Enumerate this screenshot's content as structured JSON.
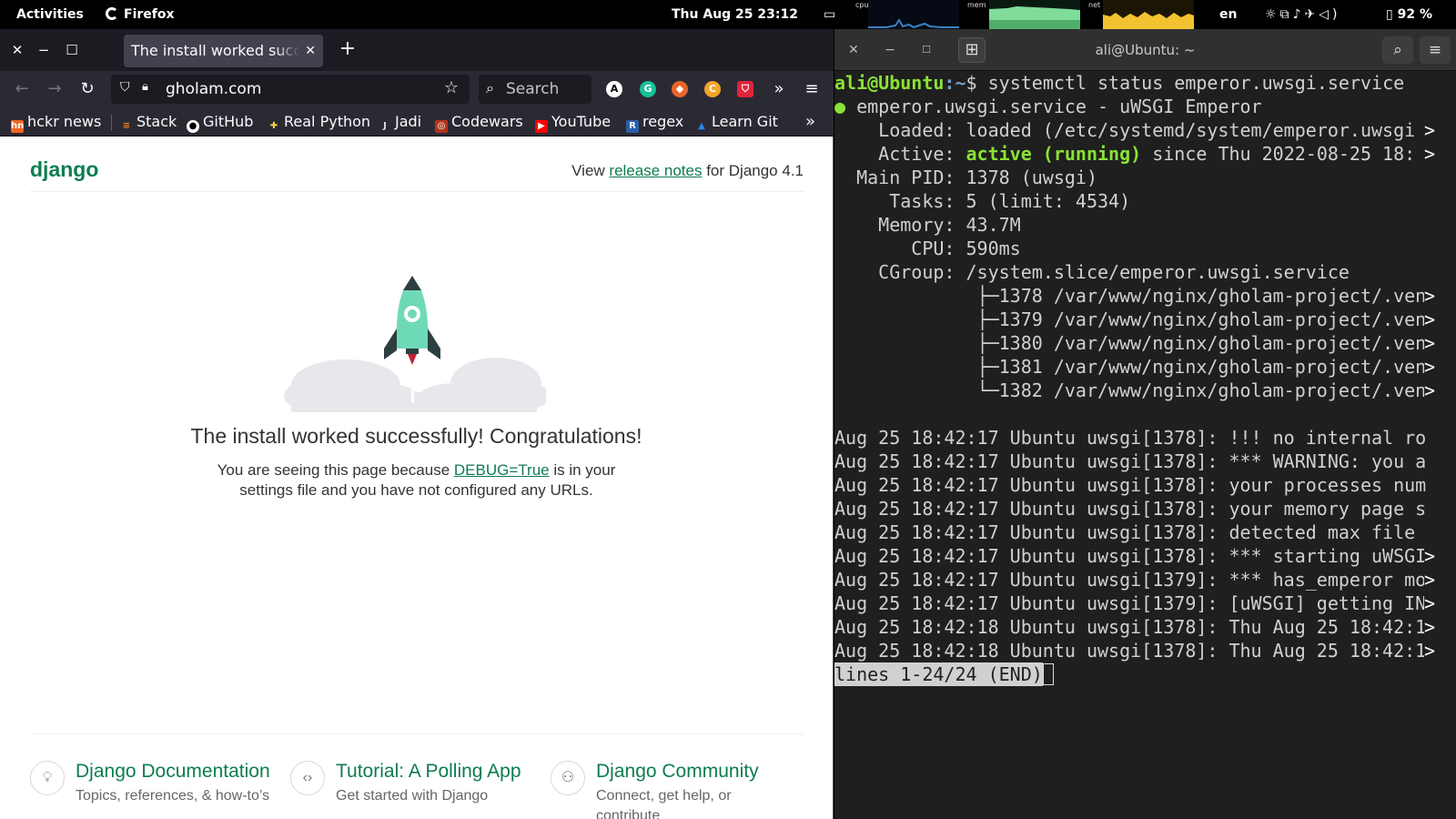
{
  "topbar": {
    "activities": "Activities",
    "app": "Firefox",
    "clock": "Thu Aug 25  23:12",
    "graph_cpu_label": "cpu",
    "graph_mem_label": "mem",
    "graph_net_label": "net",
    "lang": "en",
    "battery": "92 %",
    "status_icons": [
      "brightness-icon",
      "network-icon",
      "notifications-icon",
      "airplane-icon",
      "volume-icon",
      "battery-icon"
    ]
  },
  "firefox": {
    "tab_title": "The install worked successfully! Congratulations!",
    "url": "gholam.com",
    "search_placeholder": "Search",
    "bookmarks": [
      "hckr news",
      "Stack",
      "GitHub",
      "Real Python",
      "Jadi",
      "Codewars",
      "YouTube",
      "regex",
      "Learn Git"
    ]
  },
  "django": {
    "logo": "django",
    "release_prefix": "View ",
    "release_link": "release notes",
    "release_suffix": " for Django 4.1",
    "title": "The install worked successfully! Congratulations!",
    "desc_prefix": "You are seeing this page because ",
    "desc_link": "DEBUG=True",
    "desc_line1_suffix": " is in your",
    "desc_line2": "settings file and you have not configured any URLs.",
    "cards": [
      {
        "title": "Django Documentation",
        "subtitle": "Topics, references, & how-to’s"
      },
      {
        "title": "Tutorial: A Polling App",
        "subtitle": "Get started with Django"
      },
      {
        "title": "Django Community",
        "subtitle": "Connect, get help, or contribute"
      }
    ]
  },
  "terminal": {
    "title": "ali@Ubuntu: ~",
    "prompt_user": "ali@Ubuntu",
    "prompt_path": ":~",
    "prompt_symbol": "$ ",
    "command": "systemctl status emperor.uwsgi.service",
    "unit_line": " emperor.uwsgi.service - uWSGI Emperor",
    "loaded": "    Loaded: loaded (/etc/systemd/system/emperor.uwsgi",
    "active_label": "    Active: ",
    "active_state": "active (running)",
    "active_rest": " since Thu 2022-08-25 18:",
    "main_pid": "  Main PID: 1378 (uwsgi)",
    "tasks": "     Tasks: 5 (limit: 4534)",
    "memory": "    Memory: 43.7M",
    "cpu": "       CPU: 590ms",
    "cgroup": "    CGroup: /system.slice/emperor.uwsgi.service",
    "cgroup_children": [
      "             ├─1378 /var/www/nginx/gholam-project/.ven",
      "             ├─1379 /var/www/nginx/gholam-project/.ven",
      "             ├─1380 /var/www/nginx/gholam-project/.ven",
      "             ├─1381 /var/www/nginx/gholam-project/.ven",
      "             └─1382 /var/www/nginx/gholam-project/.ven"
    ],
    "logs": [
      "Aug 25 18:42:17 Ubuntu uwsgi[1378]: !!! no internal ro",
      "Aug 25 18:42:17 Ubuntu uwsgi[1378]: *** WARNING: you a",
      "Aug 25 18:42:17 Ubuntu uwsgi[1378]: your processes num",
      "Aug 25 18:42:17 Ubuntu uwsgi[1378]: your memory page s",
      "Aug 25 18:42:17 Ubuntu uwsgi[1378]: detected max file ",
      "Aug 25 18:42:17 Ubuntu uwsgi[1378]: *** starting uWSGI",
      "Aug 25 18:42:17 Ubuntu uwsgi[1379]: *** has_emperor mo",
      "Aug 25 18:42:17 Ubuntu uwsgi[1379]: [uWSGI] getting IN",
      "Aug 25 18:42:18 Ubuntu uwsgi[1378]: Thu Aug 25 18:42:1",
      "Aug 25 18:42:18 Ubuntu uwsgi[1378]: Thu Aug 25 18:42:1"
    ],
    "pager": "lines 1-24/24 (END)"
  }
}
